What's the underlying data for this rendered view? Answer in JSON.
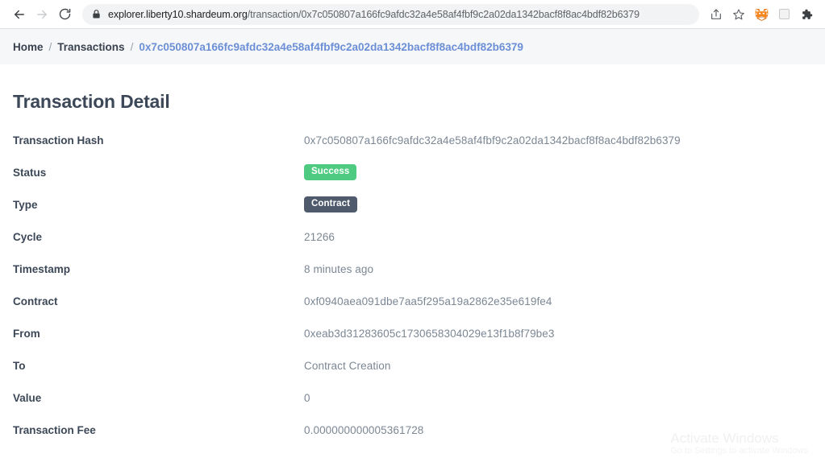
{
  "browser": {
    "back_label": "Back",
    "forward_label": "Forward",
    "reload_label": "Reload",
    "lock_icon": "lock-icon",
    "url_host": "explorer.liberty10.shardeum.org",
    "url_path": "/transaction/0x7c050807a166fc9afdc32a4e58af4fbf9c2a02da1342bacf8f8ac4bdf82b6379",
    "url_full": "explorer.liberty10.shardeum.org/transaction/0x7c050807a166fc9afdc32a4e58af4fbf9c2a02da1342bacf8f8ac4bdf82b6379",
    "toolbar_icons": [
      {
        "name": "share-icon",
        "label": "Share this page"
      },
      {
        "name": "bookmark-star-icon",
        "label": "Bookmark this tab"
      },
      {
        "name": "metamask-fox-icon",
        "label": "MetaMask"
      },
      {
        "name": "blank-extension-icon",
        "label": "Extension"
      },
      {
        "name": "extensions-puzzle-icon",
        "label": "Extensions"
      }
    ]
  },
  "breadcrumb": {
    "items": [
      {
        "label": "Home",
        "active": false
      },
      {
        "label": "Transactions",
        "active": false
      },
      {
        "label": "0x7c050807a166fc9afdc32a4e58af4fbf9c2a02da1342bacf8f8ac4bdf82b6379",
        "active": true
      }
    ],
    "separator": "/"
  },
  "main": {
    "title": "Transaction Detail",
    "rows": [
      {
        "label": "Transaction Hash",
        "value": "0x7c050807a166fc9afdc32a4e58af4fbf9c2a02da1342bacf8f8ac4bdf82b6379",
        "type": "text"
      },
      {
        "label": "Status",
        "value": "Success",
        "type": "badge-success"
      },
      {
        "label": "Type",
        "value": "Contract",
        "type": "badge-contract"
      },
      {
        "label": "Cycle",
        "value": "21266",
        "type": "text"
      },
      {
        "label": "Timestamp",
        "value": "8 minutes ago",
        "type": "text"
      },
      {
        "label": "Contract",
        "value": "0xf0940aea091dbe7aa5f295a19a2862e35e619fe4",
        "type": "text"
      },
      {
        "label": "From",
        "value": "0xeab3d31283605c1730658304029e13f1b8f79be3",
        "type": "text"
      },
      {
        "label": "To",
        "value": "Contract Creation",
        "type": "text"
      },
      {
        "label": "Value",
        "value": "0",
        "type": "text"
      },
      {
        "label": "Transaction Fee",
        "value": "0.000000000005361728",
        "type": "text"
      }
    ]
  },
  "watermark": {
    "line1": "Activate Windows",
    "line2": "Go to Settings to activate Windows."
  },
  "colors": {
    "badge_success": "#4ecb80",
    "badge_contract": "#4f5b6d",
    "breadcrumb_bg": "#f5f7f9",
    "crumb_link": "#6c8fd6",
    "label_text": "#3c4858",
    "value_text": "#7b8794"
  }
}
